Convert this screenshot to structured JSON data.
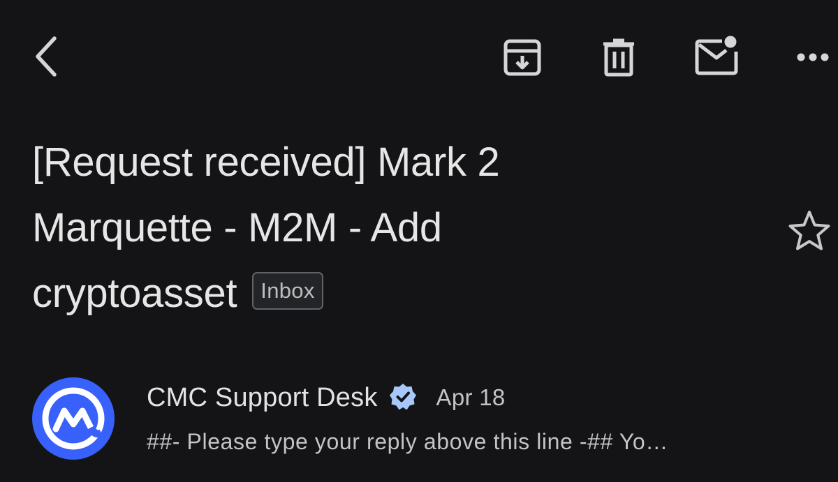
{
  "toolbar": {
    "back_icon": "back-arrow-icon",
    "archive_icon": "archive-icon",
    "delete_icon": "trash-icon",
    "mark_unread_icon": "mail-unread-icon",
    "more_icon": "more-horizontal-icon"
  },
  "email": {
    "subject_line1": "[Request received] Mark 2",
    "subject_line2": "Marquette - M2M - Add",
    "subject_line3": "cryptoasset",
    "label": "Inbox",
    "starred": false,
    "star_icon": "star-outline-icon"
  },
  "message": {
    "sender": "CMC Support Desk",
    "verified_icon": "verified-badge-icon",
    "date": "Apr 18",
    "snippet": "##- Please type your reply above this line -## Yo…",
    "avatar_icon": "coinmarketcap-logo-icon"
  },
  "colors": {
    "background": "#141416",
    "text_primary": "#e6e6e6",
    "text_secondary": "#c4c4c4",
    "avatar_blue": "#3861fb",
    "verified_blue": "#a8c7fa"
  }
}
